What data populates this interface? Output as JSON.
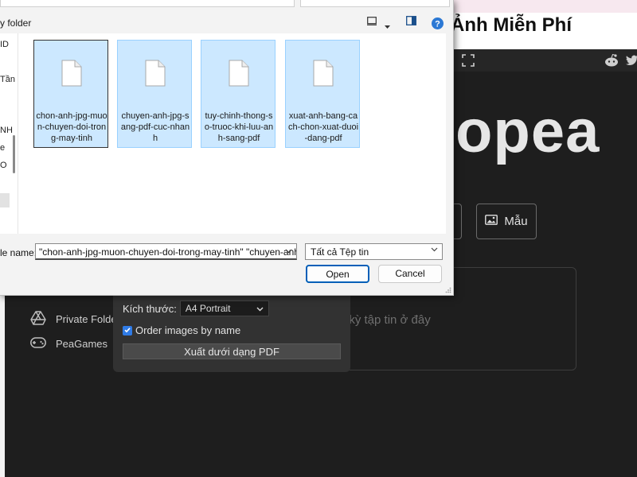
{
  "dialog": {
    "new_folder_label": "y folder",
    "nav_fragments": [
      "ID",
      "Tần",
      "NH",
      "e",
      "O"
    ],
    "files": [
      {
        "name": "chon-anh-jpg-muon-chuyen-doi-trong-may-tinh"
      },
      {
        "name": "chuyen-anh-jpg-sang-pdf-cuc-nhanh"
      },
      {
        "name": "tuy-chinh-thong-so-truoc-khi-luu-anh-sang-pdf"
      },
      {
        "name": "xuat-anh-bang-cach-chon-xuat-duoi-dang-pdf"
      }
    ],
    "file_name_label": "le name:",
    "file_name_value": "\"chon-anh-jpg-muon-chuyen-doi-trong-may-tinh\" \"chuyen-anh-",
    "file_type_value": "Tất cả Tệp tin",
    "open_label": "Open",
    "cancel_label": "Cancel"
  },
  "page": {
    "title": "Ảnh Miễn Phí",
    "logo": "opea",
    "template_button": "Mẫu",
    "dropzone_text": "t kỳ tập tin ở đây",
    "sidebar": [
      {
        "label": "Private Folde",
        "icon": "drive-icon"
      },
      {
        "label": "PeaGames",
        "icon": "gamepad-icon"
      }
    ]
  },
  "pdf_panel": {
    "size_label": "Kích thước:",
    "size_value": "A4 Portrait",
    "order_label": "Order images by name",
    "order_checked": true,
    "export_label": "Xuất dưới dạng PDF"
  },
  "colors": {
    "selection": "#cce8ff",
    "selection_border": "#99d1ff",
    "primary_border": "#005fb8",
    "page_bg": "#1e1e1e"
  }
}
